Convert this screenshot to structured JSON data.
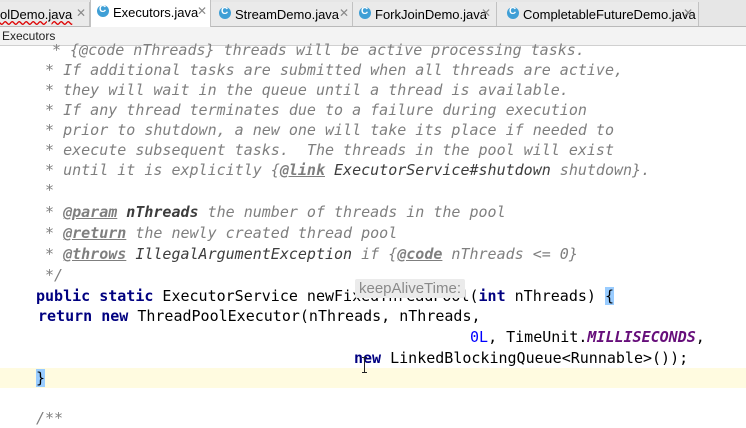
{
  "tabs": [
    {
      "label": "olDemo.java",
      "active": false,
      "error": true
    },
    {
      "label": "Executors.java",
      "active": true,
      "error": false
    },
    {
      "label": "StreamDemo.java",
      "active": false,
      "error": false
    },
    {
      "label": "ForkJoinDemo.java",
      "active": false,
      "error": false
    },
    {
      "label": "CompletableFutureDemo.java",
      "active": false,
      "error": false
    }
  ],
  "breadcrumb": "Executors",
  "code": {
    "l1": "* {@code nThreads} threads will be active processing tasks.",
    "l2": " * If additional tasks are submitted when all threads are active,",
    "l3": " * they will wait in the queue until a thread is available.",
    "l4": " * If any thread terminates due to a failure during execution",
    "l5": " * prior to shutdown, a new one will take its place if needed to",
    "l6": " * execute subsequent tasks.  The threads in the pool will exist",
    "l7_pre": " * until it is explicitly {",
    "l7_tag": "@link",
    "l7_ref": " ExecutorService#shutdown",
    "l7_post": " shutdown}.",
    "l8": " *",
    "l9_pre": " * ",
    "l9_tag": "@param",
    "l9_arg": " nThreads",
    "l9_post": " the number of threads in the pool",
    "l10_pre": " * ",
    "l10_tag": "@return",
    "l10_post": " the newly created thread pool",
    "l11_pre": " * ",
    "l11_tag": "@throws",
    "l11_arg": " IllegalArgumentException",
    "l11_mid": " if {",
    "l11_tag2": "@code",
    "l11_post": " nThreads <= 0}",
    "l12": " */",
    "l13_kw": "public static",
    "l13_rest": " ExecutorService newFixedThreadPool(",
    "l13_kw2": "int",
    "l13_rest2": " nThreads) ",
    "l13_brace": "{",
    "l14_pad": "     ",
    "l14_kw": "return new",
    "l14_rest": " ThreadPoolExecutor(nThreads, nThreads,",
    "l15_hint": "keepAliveTime:",
    "l15_num": "0L",
    "l15_mid": ", TimeUnit.",
    "l15_const": "MILLISECONDS",
    "l15_post": ",",
    "l16_pad": "                               ",
    "l16_kw": "new",
    "l16_rest": " LinkedBlockingQueue<Runnable>());",
    "l17_brace": "}",
    "l19": "/**"
  }
}
